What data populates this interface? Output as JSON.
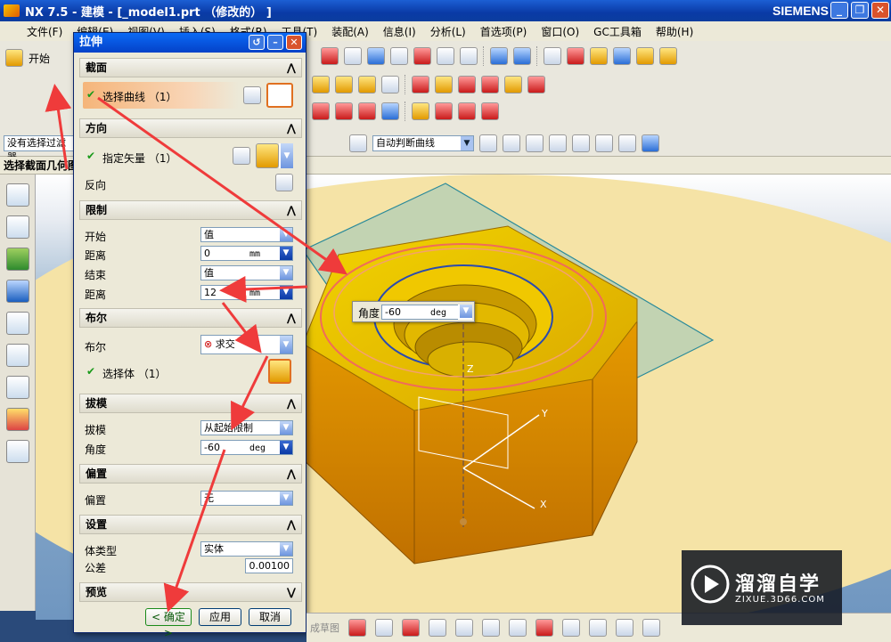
{
  "window": {
    "title": "NX 7.5 - 建模 - [_model1.prt （修改的） ]",
    "brand": "SIEMENS"
  },
  "menu": [
    "文件(F)",
    "编辑(E)",
    "视图(V)",
    "插入(S)",
    "格式(R)",
    "工具(T)",
    "装配(A)",
    "信息(I)",
    "分析(L)",
    "首选项(P)",
    "窗口(O)",
    "GC工具箱",
    "帮助(H)"
  ],
  "toolbar": {
    "start_label": "开始",
    "filter_label": "没有选择过滤器",
    "curve_rule": "自动判断曲线"
  },
  "cue_line": "选择截面几何图形",
  "dialog": {
    "title": "拉伸",
    "section": {
      "header": "截面",
      "select_curve": "选择曲线 （1）"
    },
    "direction": {
      "header": "方向",
      "specify_vector": "指定矢量 （1）",
      "reverse": "反向"
    },
    "limits": {
      "header": "限制",
      "start_label": "开始",
      "start_value": "值",
      "distance1_label": "距离",
      "distance1_value": "0",
      "distance1_unit": "mm",
      "end_label": "结束",
      "end_value": "值",
      "distance2_label": "距离",
      "distance2_value": "12",
      "distance2_unit": "mm"
    },
    "boolean": {
      "header": "布尔",
      "label": "布尔",
      "value": "求交",
      "select_body": "选择体 （1）"
    },
    "draft": {
      "header": "拔模",
      "label": "拔模",
      "value": "从起始限制",
      "angle_label": "角度",
      "angle_value": "-60",
      "angle_unit": "deg"
    },
    "offset": {
      "header": "偏置",
      "label": "偏置",
      "value": "无"
    },
    "settings": {
      "header": "设置",
      "body_type_label": "体类型",
      "body_type_value": "实体",
      "tolerance_label": "公差",
      "tolerance_value": "0.00100"
    },
    "preview": {
      "header": "预览"
    },
    "buttons": {
      "ok": "< 确定 >",
      "apply": "应用",
      "cancel": "取消"
    }
  },
  "angle_popup": {
    "label": "角度",
    "value": "-60",
    "unit": "deg"
  },
  "axes": {
    "x": "X",
    "y": "Y",
    "z": "Z"
  },
  "watermark": {
    "title": "溜溜自学",
    "url": "ZIXUE.3D66.COM"
  },
  "bottom": {
    "sketch_label": "成草图"
  },
  "colors": {
    "titlebar": "#0a3aa6",
    "nut": "#e8b400",
    "nut_side": "#cf8a00",
    "arrow": "#ef3b3b",
    "section_highlight": "#f5b57a"
  }
}
